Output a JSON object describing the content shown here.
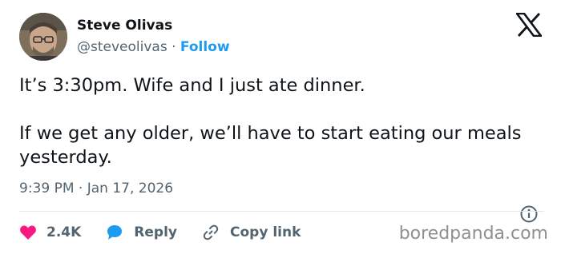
{
  "tweet": {
    "author_name": "Steve Olivas",
    "author_handle": "@steveolivas",
    "handle_separator": " · ",
    "follow_label": "Follow",
    "text": "It’s 3:30pm. Wife and I just ate dinner.\n\nIf we get any older, we’ll have to start eating our meals yesterday.",
    "timestamp": "9:39 PM · Jan 17, 2026"
  },
  "actions": {
    "like_count": "2.4K",
    "reply_label": "Reply",
    "copy_link_label": "Copy link"
  },
  "watermark": "boredpanda.com",
  "icons": {
    "brand": "x-logo-icon",
    "info": "info-icon",
    "like": "heart-icon",
    "reply": "speech-bubble-icon",
    "copy": "link-icon"
  },
  "colors": {
    "text": "#0f1419",
    "secondary": "#536471",
    "accent": "#1d9bf0",
    "like": "#f91880",
    "divider": "#e1e8ed",
    "watermark": "#909090"
  }
}
